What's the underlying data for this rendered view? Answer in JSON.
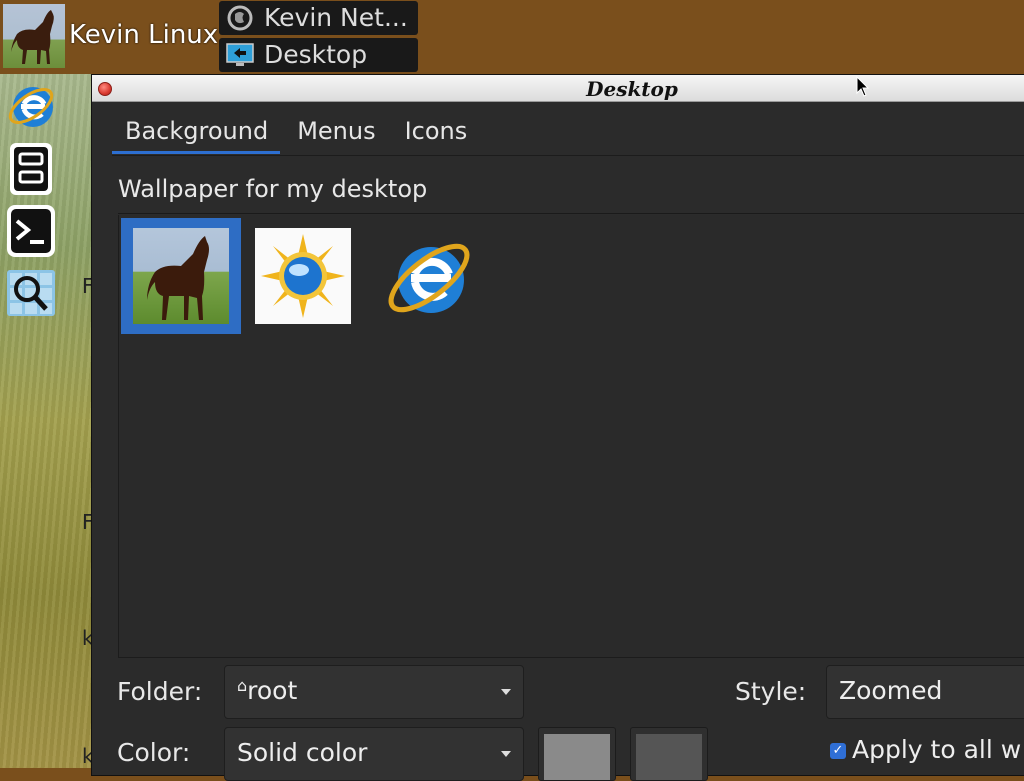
{
  "panel": {
    "user_name": "Kevin Linux",
    "tasks": [
      {
        "label": "Kevin Net...",
        "icon": "firefox-icon"
      },
      {
        "label": "Desktop",
        "icon": "desktop-icon"
      }
    ]
  },
  "launcher": {
    "items": [
      {
        "icon": "ie-icon"
      },
      {
        "icon": "file-manager-icon"
      },
      {
        "icon": "terminal-icon"
      },
      {
        "icon": "search-icon"
      }
    ]
  },
  "wallpaper_peek": [
    "F",
    "F",
    "k",
    "k"
  ],
  "dialog": {
    "title": "Desktop",
    "tabs": [
      {
        "label": "Background",
        "active": true
      },
      {
        "label": "Menus",
        "active": false
      },
      {
        "label": "Icons",
        "active": false
      }
    ],
    "section_title": "Wallpaper for my desktop",
    "wallpapers": [
      {
        "name": "horse-thumbnail",
        "selected": true
      },
      {
        "name": "sun-globe-thumbnail",
        "selected": false
      },
      {
        "name": "ie-logo-thumbnail",
        "selected": false
      }
    ],
    "folder_label": "Folder:",
    "folder_value": "root",
    "folder_icon": "⌂",
    "style_label": "Style:",
    "style_value": "Zoomed",
    "color_label": "Color:",
    "color_value": "Solid color",
    "primary_color": "#8a8a8a",
    "secondary_color": "#555555",
    "apply_label": "Apply to all w",
    "apply_checked": true
  },
  "colors": {
    "panel_bg": "#7a4f1c",
    "dialog_bg": "#2b2b2b",
    "accent": "#2d6fd1"
  }
}
